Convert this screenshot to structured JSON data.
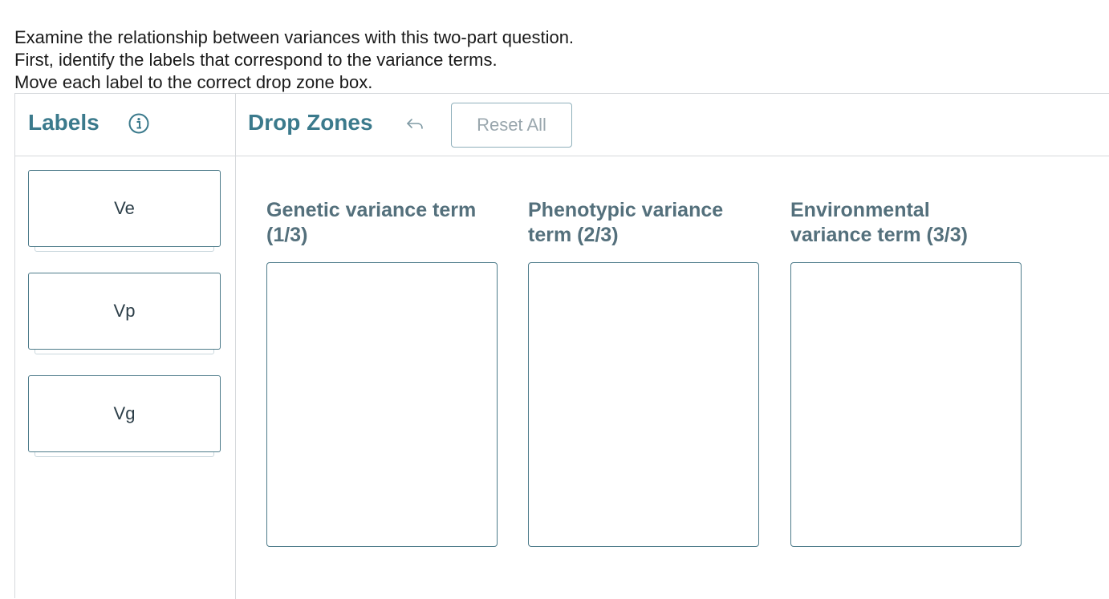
{
  "instructions": [
    "Examine the relationship between variances with this two-part question.",
    "First, identify the labels that correspond to the variance terms.",
    "Move each label to the correct drop zone box."
  ],
  "labels_panel": {
    "title": "Labels",
    "info_icon": "info-circle-icon",
    "items": [
      "Ve",
      "Vp",
      "Vg"
    ]
  },
  "drop_panel": {
    "title": "Drop Zones",
    "undo_icon": "undo-arrow-icon",
    "reset_label": "Reset All",
    "zones": [
      {
        "heading_line1": "Genetic variance term",
        "heading_line2": "(1/3)"
      },
      {
        "heading_line1": "Phenotypic variance",
        "heading_line2": "term (2/3)"
      },
      {
        "heading_line1": "Environmental",
        "heading_line2": "variance term (3/3)"
      }
    ]
  },
  "colors": {
    "accent": "#3b7a8c",
    "border": "#4d7b8a",
    "divider": "#d6d9dc"
  }
}
